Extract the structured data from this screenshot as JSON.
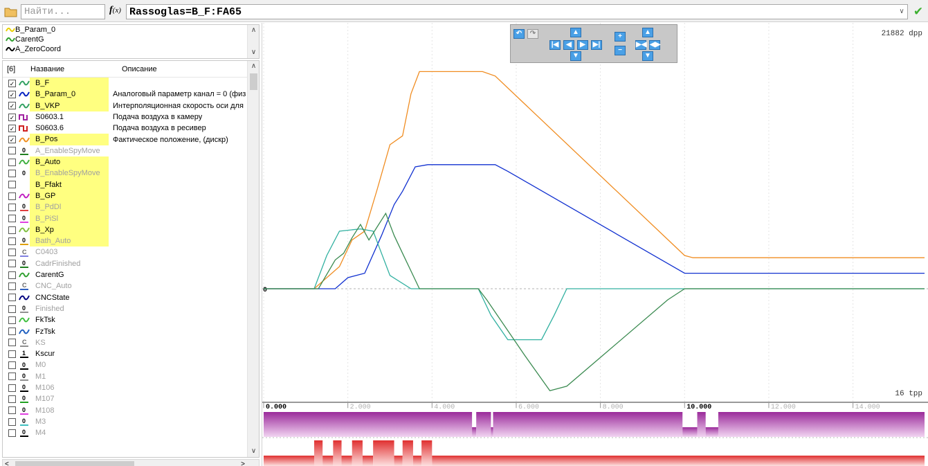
{
  "toolbar": {
    "search_placeholder": "Найти...",
    "fx_label": "f",
    "fx_sub": "(x)",
    "formula": "Rassoglas=B_F:FA65",
    "open_icon": "folder-icon",
    "apply_icon": "checkmark-icon"
  },
  "selected_signals": [
    {
      "name": "B_Param_0",
      "color": "#e8d000"
    },
    {
      "name": "CarentG",
      "color": "#30a030"
    },
    {
      "name": "A_ZeroCoord",
      "color": "#000000"
    }
  ],
  "table": {
    "col_count": "[6]",
    "col_name": "Название",
    "col_desc": "Описание",
    "rows": [
      {
        "checked": true,
        "name": "B_F",
        "desc": "",
        "hl": true,
        "dim": false,
        "icon": "wave",
        "color": "#30a060"
      },
      {
        "checked": true,
        "name": "B_Param_0",
        "desc": "Аналоговый параметр канал = 0 (физ",
        "hl": true,
        "dim": false,
        "icon": "wave",
        "color": "#0020c0"
      },
      {
        "checked": true,
        "name": "B_VKP",
        "desc": "Интерполяционная скорость оси для",
        "hl": true,
        "dim": false,
        "icon": "wave",
        "color": "#30a060"
      },
      {
        "checked": true,
        "name": "S0603.1",
        "desc": "Подача воздуха в камеру",
        "hl": false,
        "dim": false,
        "icon": "step",
        "color": "#a020a0"
      },
      {
        "checked": true,
        "name": "S0603.6",
        "desc": "Подача воздуха в ресивер",
        "hl": false,
        "dim": false,
        "icon": "step",
        "color": "#d02020"
      },
      {
        "checked": true,
        "name": "B_Pos",
        "desc": "Фактическое положение, (дискр)",
        "hl": true,
        "dim": false,
        "icon": "wave",
        "color": "#f09020"
      },
      {
        "checked": false,
        "name": "A_EnableSpyMove",
        "desc": "",
        "hl": false,
        "dim": true,
        "icon": "digit",
        "color": "#208020"
      },
      {
        "checked": false,
        "name": "B_Auto",
        "desc": "",
        "hl": true,
        "dim": false,
        "icon": "wave",
        "color": "#40b040"
      },
      {
        "checked": false,
        "name": "B_EnableSpyMove",
        "desc": "",
        "hl": true,
        "dim": true,
        "icon": "digit0",
        "color": "#000000"
      },
      {
        "checked": false,
        "name": "B_Ffakt",
        "desc": "",
        "hl": true,
        "dim": false,
        "icon": "none",
        "color": "#000000"
      },
      {
        "checked": false,
        "name": "B_GP",
        "desc": "",
        "hl": true,
        "dim": false,
        "icon": "wave",
        "color": "#c020c0"
      },
      {
        "checked": false,
        "name": "B_PdDl",
        "desc": "",
        "hl": true,
        "dim": true,
        "icon": "digit",
        "color": "#e04040"
      },
      {
        "checked": false,
        "name": "B_PiSl",
        "desc": "",
        "hl": true,
        "dim": true,
        "icon": "digit",
        "color": "#e040e0"
      },
      {
        "checked": false,
        "name": "B_Xp",
        "desc": "",
        "hl": true,
        "dim": false,
        "icon": "wave",
        "color": "#80c040"
      },
      {
        "checked": false,
        "name": "Bath_Auto",
        "desc": "",
        "hl": true,
        "dim": true,
        "icon": "digit",
        "color": "#e0a000"
      },
      {
        "checked": false,
        "name": "C0403",
        "desc": "",
        "hl": false,
        "dim": true,
        "icon": "c",
        "color": "#8080e0"
      },
      {
        "checked": false,
        "name": "CadrFinished",
        "desc": "",
        "hl": false,
        "dim": true,
        "icon": "digit",
        "color": "#208020"
      },
      {
        "checked": false,
        "name": "CarentG",
        "desc": "",
        "hl": false,
        "dim": false,
        "icon": "wave",
        "color": "#30a030"
      },
      {
        "checked": false,
        "name": "CNC_Auto",
        "desc": "",
        "hl": false,
        "dim": true,
        "icon": "c",
        "color": "#3060c0"
      },
      {
        "checked": false,
        "name": "CNCState",
        "desc": "",
        "hl": false,
        "dim": false,
        "icon": "wave",
        "color": "#000080"
      },
      {
        "checked": false,
        "name": "Finished",
        "desc": "",
        "hl": false,
        "dim": true,
        "icon": "digit",
        "color": "#909090"
      },
      {
        "checked": false,
        "name": "FkTsk",
        "desc": "",
        "hl": false,
        "dim": false,
        "icon": "wave",
        "color": "#40c040"
      },
      {
        "checked": false,
        "name": "FzTsk",
        "desc": "",
        "hl": false,
        "dim": false,
        "icon": "wave",
        "color": "#2060c0"
      },
      {
        "checked": false,
        "name": "KS",
        "desc": "",
        "hl": false,
        "dim": true,
        "icon": "c",
        "color": "#909090"
      },
      {
        "checked": false,
        "name": "Kscur",
        "desc": "",
        "hl": false,
        "dim": false,
        "icon": "one",
        "color": "#000000"
      },
      {
        "checked": false,
        "name": "M0",
        "desc": "",
        "hl": false,
        "dim": true,
        "icon": "digit",
        "color": "#000000"
      },
      {
        "checked": false,
        "name": "M1",
        "desc": "",
        "hl": false,
        "dim": true,
        "icon": "digit",
        "color": "#909090"
      },
      {
        "checked": false,
        "name": "M106",
        "desc": "",
        "hl": false,
        "dim": true,
        "icon": "digit",
        "color": "#000000"
      },
      {
        "checked": false,
        "name": "M107",
        "desc": "",
        "hl": false,
        "dim": true,
        "icon": "digit",
        "color": "#20a020"
      },
      {
        "checked": false,
        "name": "M108",
        "desc": "",
        "hl": false,
        "dim": true,
        "icon": "digit",
        "color": "#e040e0"
      },
      {
        "checked": false,
        "name": "M3",
        "desc": "",
        "hl": false,
        "dim": true,
        "icon": "digit",
        "color": "#40c0c0"
      },
      {
        "checked": false,
        "name": "M4",
        "desc": "",
        "hl": false,
        "dim": true,
        "icon": "digit",
        "color": "#000000"
      }
    ]
  },
  "plot": {
    "dpp": "21882 dpp",
    "tpp": "16 tpp",
    "zero_marker": "0",
    "axis_ticks": [
      "0.000",
      "2.000",
      "4.000",
      "6.000",
      "8.000",
      "10.000",
      "12.000",
      "14.000"
    ],
    "nav_icons": [
      "undo-icon",
      "redo-icon",
      "go-start-icon",
      "pan-icon",
      "go-end-icon",
      "zoom-in-icon",
      "zoom-out-icon",
      "fit-icon"
    ]
  },
  "chart_data": {
    "type": "line",
    "x_range": [
      0,
      15.7
    ],
    "x_ticks": [
      0,
      2,
      4,
      6,
      8,
      10,
      12,
      14
    ],
    "series": [
      {
        "name": "B_Pos",
        "color": "#f08c20",
        "points": [
          [
            0,
            0
          ],
          [
            1.2,
            0
          ],
          [
            1.8,
            1.0
          ],
          [
            2.1,
            2.2
          ],
          [
            2.4,
            2.6
          ],
          [
            2.7,
            4.5
          ],
          [
            3.0,
            6.5
          ],
          [
            3.3,
            6.9
          ],
          [
            3.5,
            8.8
          ],
          [
            3.7,
            9.8
          ],
          [
            5.2,
            9.8
          ],
          [
            5.5,
            9.6
          ],
          [
            10.0,
            1.5
          ],
          [
            10.2,
            1.4
          ],
          [
            15.7,
            1.4
          ]
        ]
      },
      {
        "name": "B_Param_0",
        "color": "#1030d0",
        "points": [
          [
            0,
            0
          ],
          [
            1.7,
            0
          ],
          [
            2.0,
            0.5
          ],
          [
            2.4,
            0.7
          ],
          [
            2.8,
            2.4
          ],
          [
            3.1,
            3.8
          ],
          [
            3.3,
            4.4
          ],
          [
            3.6,
            5.5
          ],
          [
            3.9,
            5.6
          ],
          [
            5.5,
            5.6
          ],
          [
            5.8,
            5.3
          ],
          [
            10.0,
            0.7
          ],
          [
            10.2,
            0.7
          ],
          [
            15.7,
            0.7
          ]
        ]
      },
      {
        "name": "B_F",
        "color": "#30b0a0",
        "points": [
          [
            0,
            0
          ],
          [
            1.2,
            0
          ],
          [
            1.5,
            1.5
          ],
          [
            1.8,
            2.6
          ],
          [
            2.3,
            2.7
          ],
          [
            2.6,
            2.6
          ],
          [
            2.8,
            1.6
          ],
          [
            3.0,
            0.6
          ],
          [
            3.5,
            0
          ],
          [
            5.1,
            0
          ],
          [
            5.4,
            -1.2
          ],
          [
            5.8,
            -2.3
          ],
          [
            6.6,
            -2.3
          ],
          [
            6.9,
            -1.2
          ],
          [
            7.2,
            0
          ],
          [
            15.7,
            0
          ]
        ]
      },
      {
        "name": "B_VKP",
        "color": "#3a8a50",
        "points": [
          [
            0,
            0
          ],
          [
            1.3,
            0
          ],
          [
            1.7,
            1.3
          ],
          [
            1.9,
            1.6
          ],
          [
            2.1,
            2.3
          ],
          [
            2.3,
            2.9
          ],
          [
            2.5,
            2.2
          ],
          [
            2.7,
            2.8
          ],
          [
            2.9,
            3.4
          ],
          [
            3.1,
            2.4
          ],
          [
            3.3,
            1.6
          ],
          [
            3.5,
            0.8
          ],
          [
            3.7,
            0
          ],
          [
            5.1,
            0
          ],
          [
            5.3,
            -0.5
          ],
          [
            6.2,
            -3.0
          ],
          [
            6.8,
            -4.6
          ],
          [
            7.2,
            -4.4
          ],
          [
            9.6,
            -0.5
          ],
          [
            10.0,
            0
          ],
          [
            15.7,
            0
          ]
        ]
      }
    ],
    "digital": [
      {
        "name": "S0603.1",
        "color": "#a020a0",
        "base": "high",
        "pulses": [
          [
            4.95,
            5.05
          ],
          [
            5.4,
            5.45
          ],
          [
            9.95,
            10.3
          ],
          [
            10.5,
            10.8
          ]
        ]
      },
      {
        "name": "S0603.6",
        "color": "#e03030",
        "base": "low",
        "pulses": [
          [
            1.2,
            1.4
          ],
          [
            1.65,
            1.85
          ],
          [
            2.1,
            2.35
          ],
          [
            2.6,
            3.1
          ],
          [
            3.3,
            3.55
          ],
          [
            3.75,
            4.0
          ]
        ]
      }
    ]
  }
}
